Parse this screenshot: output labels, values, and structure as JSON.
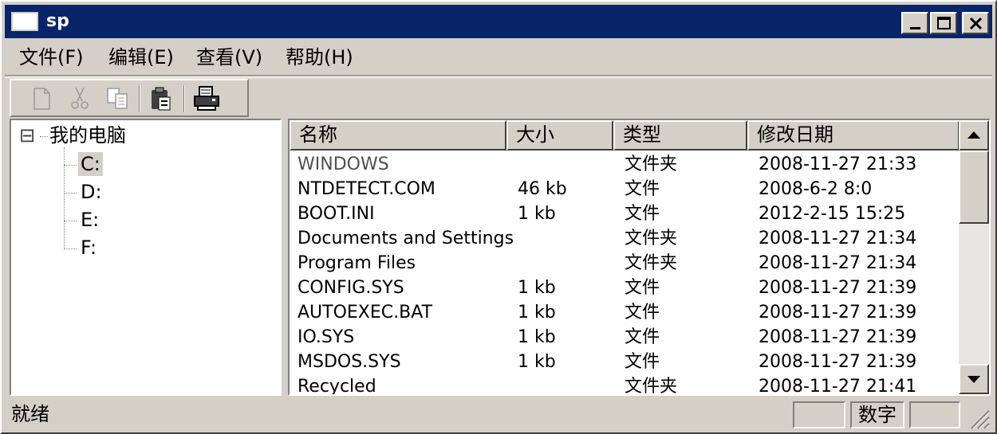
{
  "window": {
    "title": "sp"
  },
  "menu": [
    {
      "label": "文件(F)"
    },
    {
      "label": "编辑(E)"
    },
    {
      "label": "查看(V)"
    },
    {
      "label": "帮助(H)"
    }
  ],
  "toolbar": {
    "buttons": [
      {
        "icon": "new-file-icon",
        "enabled": false
      },
      {
        "icon": "cut-icon",
        "enabled": false
      },
      {
        "icon": "copy-icon",
        "enabled": false
      },
      {
        "icon": "paste-icon",
        "enabled": true
      },
      {
        "icon": "printer-icon",
        "enabled": true
      }
    ]
  },
  "tree": {
    "expand_glyph": "⊟",
    "root": "我的电脑",
    "drives": [
      "C:",
      "D:",
      "E:",
      "F:"
    ],
    "selected": "C:"
  },
  "list": {
    "columns": [
      "名称",
      "大小",
      "类型",
      "修改日期"
    ],
    "rows": [
      {
        "name": "WINDOWS",
        "size": "",
        "type": "文件夹",
        "date": "2008-11-27 21:33"
      },
      {
        "name": "NTDETECT.COM",
        "size": "46 kb",
        "type": "文件",
        "date": "2008-6-2 8:0"
      },
      {
        "name": "BOOT.INI",
        "size": "1 kb",
        "type": "文件",
        "date": "2012-2-15 15:25"
      },
      {
        "name": "Documents and Settings",
        "size": "",
        "type": "文件夹",
        "date": "2008-11-27 21:34"
      },
      {
        "name": "Program Files",
        "size": "",
        "type": "文件夹",
        "date": "2008-11-27 21:34"
      },
      {
        "name": "CONFIG.SYS",
        "size": "1 kb",
        "type": "文件",
        "date": "2008-11-27 21:39"
      },
      {
        "name": "AUTOEXEC.BAT",
        "size": "1 kb",
        "type": "文件",
        "date": "2008-11-27 21:39"
      },
      {
        "name": "IO.SYS",
        "size": "1 kb",
        "type": "文件",
        "date": "2008-11-27 21:39"
      },
      {
        "name": "MSDOS.SYS",
        "size": "1 kb",
        "type": "文件",
        "date": "2008-11-27 21:39"
      },
      {
        "name": "Recycled",
        "size": "",
        "type": "文件夹",
        "date": "2008-11-27 21:41"
      }
    ]
  },
  "status": {
    "text": "就绪",
    "indicators": [
      "",
      "数字",
      ""
    ]
  }
}
